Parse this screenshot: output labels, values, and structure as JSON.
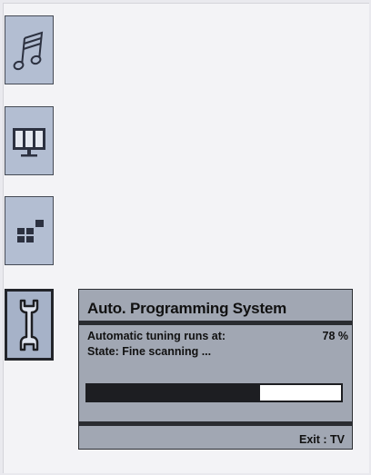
{
  "menu": {
    "icons": [
      {
        "name": "music-icon",
        "label": ""
      },
      {
        "name": "picture-icon",
        "label": ""
      },
      {
        "name": "features-icon",
        "label": ""
      },
      {
        "name": "wrench-icon",
        "label": ""
      }
    ],
    "selected_icon": "wrench-icon"
  },
  "dialog": {
    "title": "Auto. Programming System",
    "tuning_label": "Automatic tuning runs at:",
    "tuning_percent_text": "78 %",
    "progress_fraction": 0.68,
    "state_text": "State: Fine scanning ...",
    "exit_hint": "Exit : TV"
  },
  "colors": {
    "background": "#f3f3f6",
    "icon_tile": "#b3bed2",
    "dialog_bg": "#a1a7b3",
    "dark": "#1d1e22"
  }
}
